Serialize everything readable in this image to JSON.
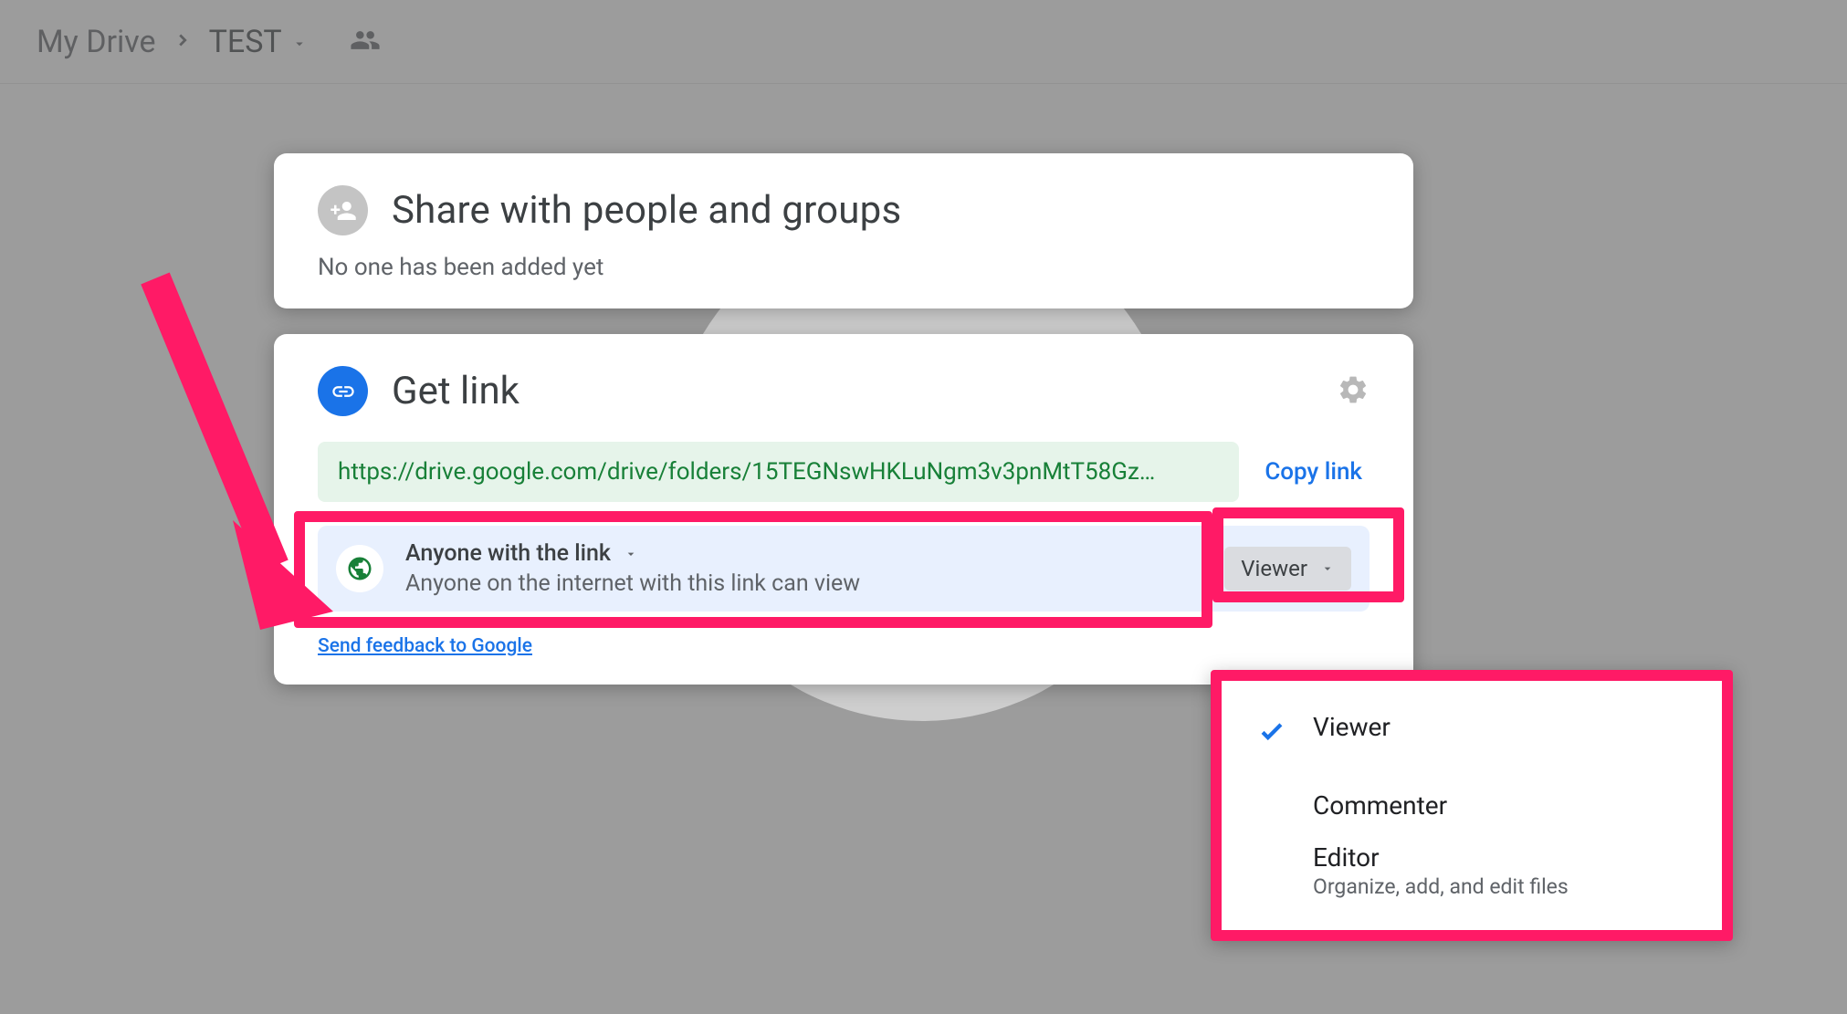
{
  "breadcrumb": {
    "root": "My Drive",
    "current": "TEST"
  },
  "share_card": {
    "title": "Share with people and groups",
    "sub": "No one has been added yet"
  },
  "link_card": {
    "title": "Get link",
    "url": "https://drive.google.com/drive/folders/15TEGNswHKLuNgm3v3pnMtT58Gz…",
    "copy": "Copy link",
    "access_label": "Anyone with the link",
    "access_desc": "Anyone on the internet with this link can view",
    "role": "Viewer",
    "feedback": "Send feedback to Google"
  },
  "dropdown": {
    "viewer": "Viewer",
    "commenter": "Commenter",
    "editor": "Editor",
    "editor_sub": "Organize, add, and edit files"
  }
}
